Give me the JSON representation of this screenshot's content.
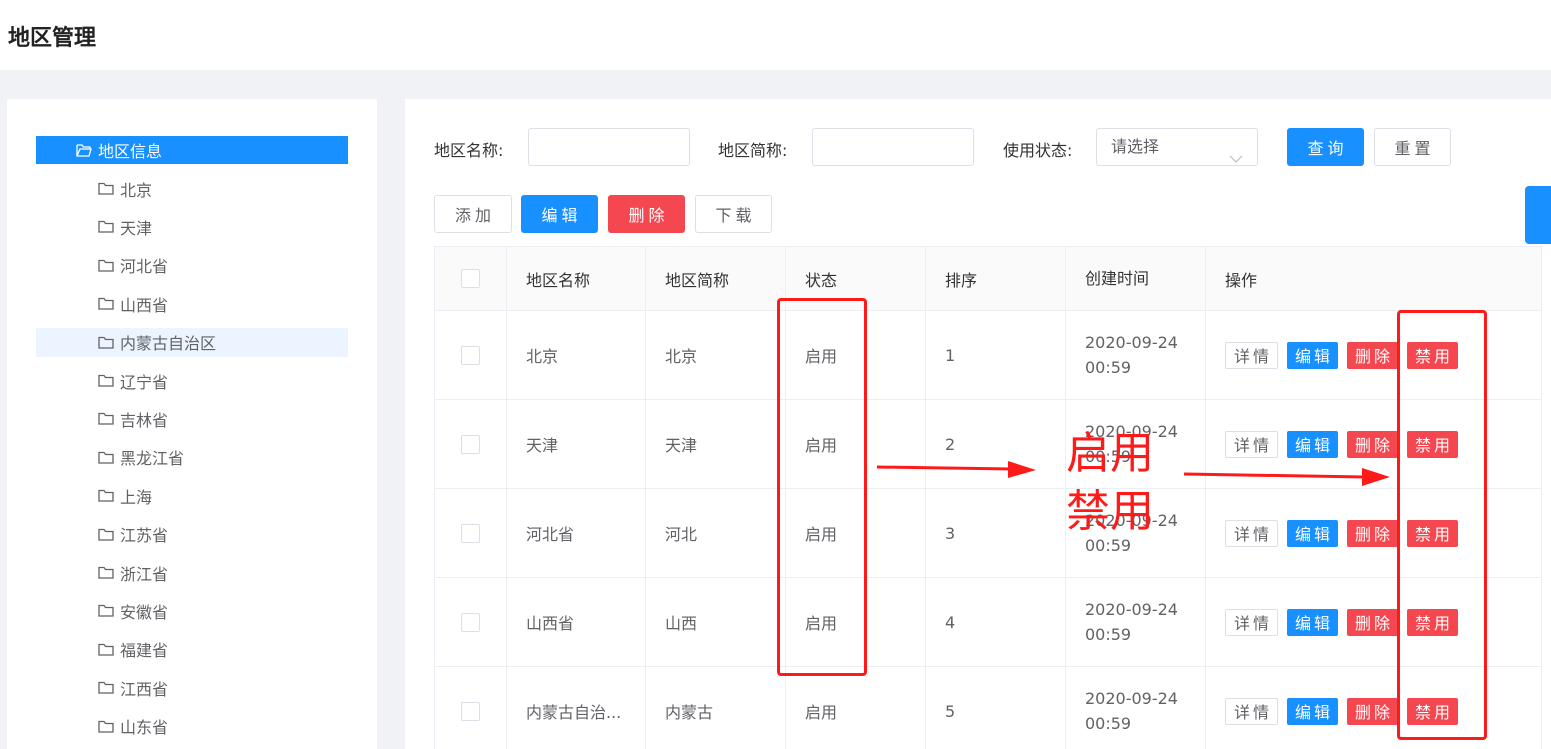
{
  "page": {
    "title": "地区管理"
  },
  "tree": {
    "root": "地区信息",
    "nodes": [
      "北京",
      "天津",
      "河北省",
      "山西省",
      "内蒙古自治区",
      "辽宁省",
      "吉林省",
      "黑龙江省",
      "上海",
      "江苏省",
      "浙江省",
      "安徽省",
      "福建省",
      "江西省",
      "山东省"
    ],
    "highlighted": "内蒙古自治区"
  },
  "filters": {
    "name_label": "地区名称:",
    "abbr_label": "地区简称:",
    "status_label": "使用状态:",
    "status_placeholder": "请选择",
    "query": "查询",
    "reset": "重置"
  },
  "toolbar": {
    "add": "添加",
    "edit": "编辑",
    "delete": "删除",
    "download": "下载"
  },
  "table": {
    "headers": [
      "地区名称",
      "地区简称",
      "状态",
      "排序",
      "创建时间",
      "操作"
    ],
    "rows": [
      {
        "name": "北京",
        "abbr": "北京",
        "status": "启用",
        "order": "1",
        "date": "2020-09-24",
        "time": "00:59"
      },
      {
        "name": "天津",
        "abbr": "天津",
        "status": "启用",
        "order": "2",
        "date": "2020-09-24",
        "time": "00:59"
      },
      {
        "name": "河北省",
        "abbr": "河北",
        "status": "启用",
        "order": "3",
        "date": "2020-09-24",
        "time": "00:59"
      },
      {
        "name": "山西省",
        "abbr": "山西",
        "status": "启用",
        "order": "4",
        "date": "2020-09-24",
        "time": "00:59"
      },
      {
        "name": "内蒙古自治...",
        "abbr": "内蒙古",
        "status": "启用",
        "order": "5",
        "date": "2020-09-24",
        "time": "00:59"
      }
    ],
    "ops": {
      "detail": "详情",
      "edit": "编辑",
      "delete": "删除",
      "disable": "禁用"
    }
  },
  "annotation": {
    "line1": "启用",
    "line2": "禁用",
    "color": "#ff1a1a"
  },
  "colors": {
    "primary": "#1890ff",
    "danger": "#f5474f"
  }
}
